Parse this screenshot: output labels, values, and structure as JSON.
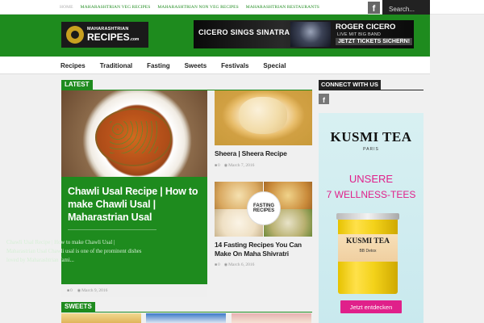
{
  "topnav": {
    "items": [
      "HOME",
      "MAHARASHTRIAN VEG RECIPES",
      "MAHARASHTRIAN NON VEG RECIPES",
      "MAHARASHTRIAN RESTAURANTS"
    ],
    "facebook_glyph": "f",
    "search_placeholder": "Search..."
  },
  "logo": {
    "line1": "MAHARASHTRIAN",
    "line2": "RECIPES",
    "suffix": ".com"
  },
  "banner": {
    "left_text": "CICERO SINGS SINATRA",
    "title": "ROGER CICERO",
    "subtitle": "LIVE MIT BIG BAND",
    "cta": "JETZT TICKETS SICHERN!"
  },
  "mainnav": {
    "items": [
      "Recipes",
      "Traditional",
      "Fasting",
      "Sweets",
      "Festivals",
      "Special"
    ]
  },
  "latest": {
    "label": "LATEST",
    "feature": {
      "title": "Chawli Usal Recipe | How to make Chawli Usal | Maharastrian Usal",
      "excerpt": "Chawli Usal Recipe | How to make Chawli Usal | Maharastrian Usal      Chawli usal is one of the prominent dishes loved by Maharashtrian fami...",
      "comments": "0",
      "date": "March 9, 2016"
    },
    "cards": [
      {
        "title": "Sheera | Sheera Recipe",
        "comments": "0",
        "date": "March 7, 2016"
      },
      {
        "title": "14 Fasting Recipes You Can Make On Maha Shivratri",
        "comments": "0",
        "date": "March 6, 2016",
        "badge_line1": "FASTING",
        "badge_line2": "RECIPES"
      }
    ]
  },
  "sidebar": {
    "connect_label": "CONNECT WITH US",
    "facebook_glyph": "f",
    "ad": {
      "brand": "KUSMI TEA",
      "city": "PARIS",
      "line1": "UNSERE",
      "line2": "7 WELLNESS-TEES",
      "tin_label": "KUSMI TEA",
      "tin_sub": "BB Detox",
      "button": "Jetzt entdecken"
    }
  },
  "sweets": {
    "label": "SWEETS"
  },
  "colors": {
    "brand_green": "#1e8b1e",
    "ad_pink": "#e0208a",
    "dark": "#222222"
  }
}
